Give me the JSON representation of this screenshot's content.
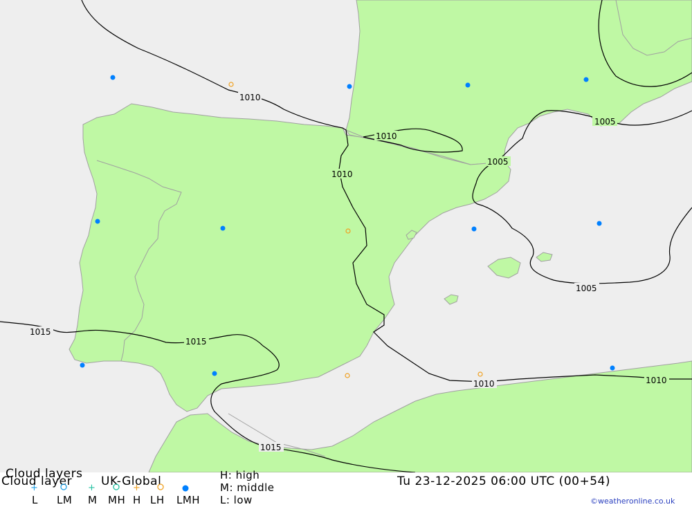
{
  "title": "Cloud layers",
  "product": "Cloud layer",
  "model": "UK-Global",
  "valid_time": "Tu 23-12-2025 06:00 UTC (00+54)",
  "credit": "©weatheronline.co.uk",
  "height_key": {
    "high": "H: high",
    "middle": "M: middle",
    "low": "L: low"
  },
  "layer_codes": [
    "L",
    "LM",
    "M",
    "MH",
    "H",
    "LH",
    "LMH"
  ],
  "layer_symbols": [
    {
      "code": "L",
      "shape": "plus",
      "color": "#1ea0e6"
    },
    {
      "code": "LM",
      "shape": "ring",
      "color": "#1ea0e6"
    },
    {
      "code": "M",
      "shape": "plus",
      "color": "#20c0a0"
    },
    {
      "code": "MH",
      "shape": "ring",
      "color": "#20c0a0"
    },
    {
      "code": "H",
      "shape": "plus",
      "color": "#f0a020"
    },
    {
      "code": "LH",
      "shape": "ring",
      "color": "#f0a020"
    },
    {
      "code": "LMH",
      "shape": "filled-dot",
      "color": "#0080ff"
    }
  ],
  "isobar_labels": [
    "1010",
    "1010",
    "1010",
    "1005",
    "1005",
    "1005",
    "1015",
    "1015",
    "1015",
    "1010",
    "1010"
  ],
  "colors": {
    "sea": "#eeeeee",
    "land": "#bff8a4",
    "isobar": "#000000",
    "coast": "#a0a0a0"
  }
}
